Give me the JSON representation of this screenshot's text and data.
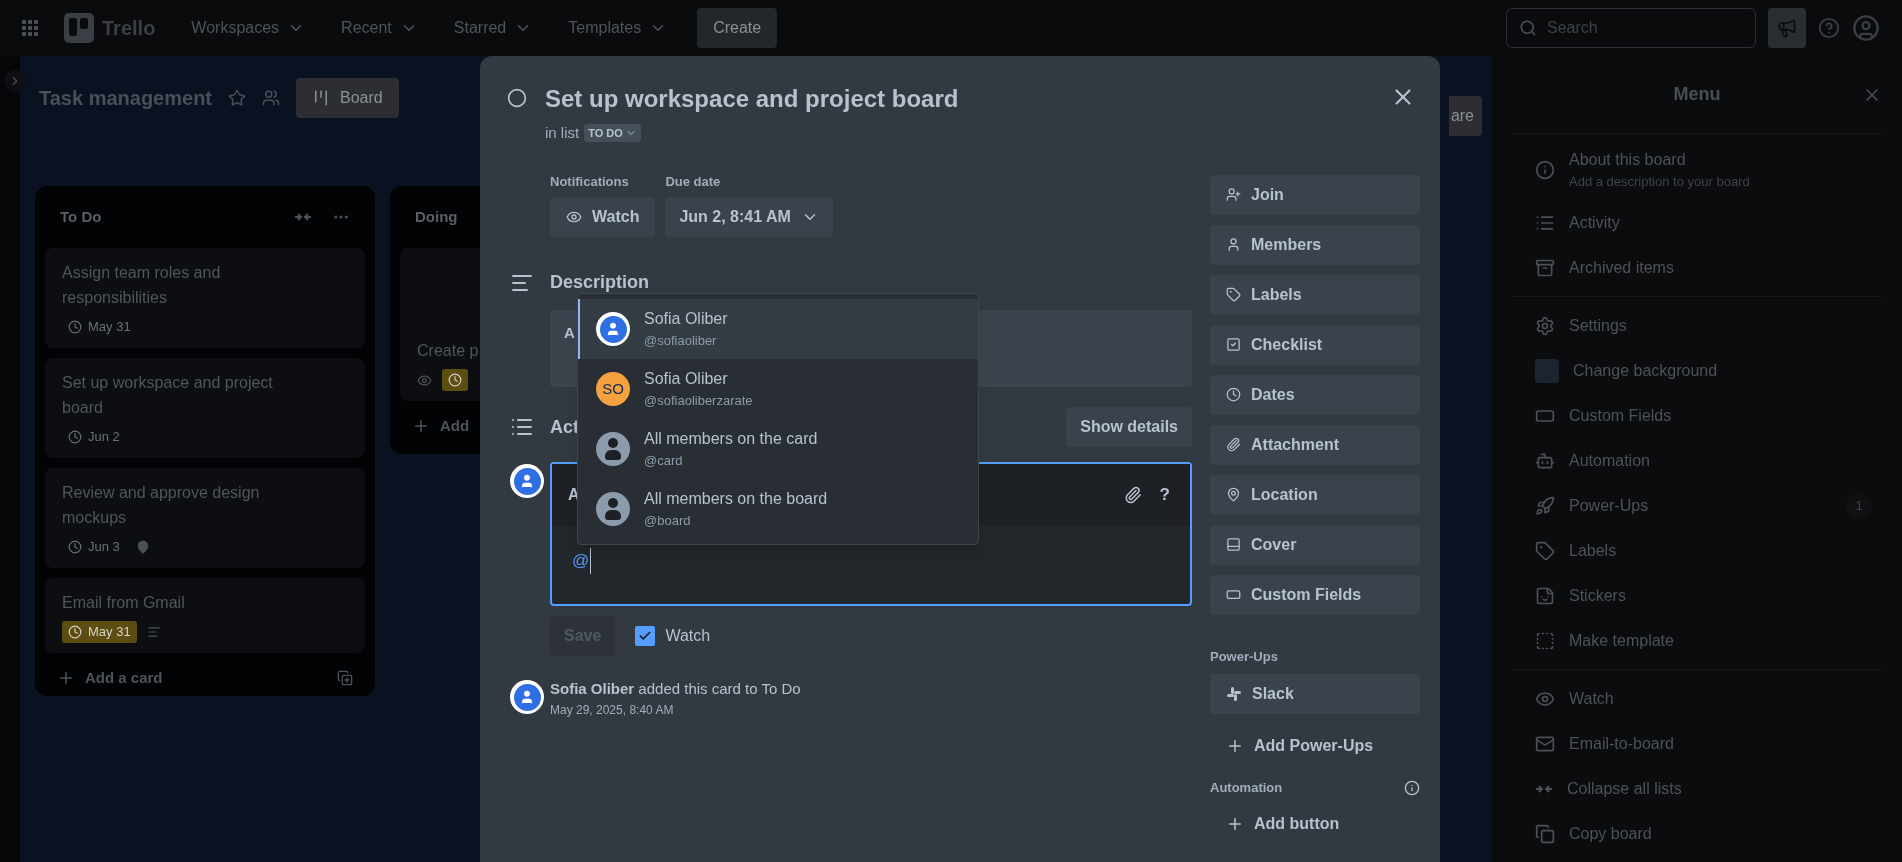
{
  "topbar": {
    "logo": "Trello",
    "nav": [
      {
        "label": "Workspaces"
      },
      {
        "label": "Recent"
      },
      {
        "label": "Starred"
      },
      {
        "label": "Templates"
      }
    ],
    "create": "Create",
    "search": {
      "placeholder": "Search"
    }
  },
  "board": {
    "title": "Task management",
    "view_button": "Board",
    "share_button": "are",
    "lists": [
      {
        "title": "To Do",
        "add_label": "Add a card",
        "cards": [
          {
            "title": "Assign team roles and responsibilities",
            "badges": [
              {
                "kind": "due",
                "text": "May 31",
                "highlight": false
              }
            ]
          },
          {
            "title": "Set up workspace and project board",
            "badges": [
              {
                "kind": "due",
                "text": "Jun 2",
                "highlight": false
              }
            ]
          },
          {
            "title": "Review and approve design mockups",
            "badges": [
              {
                "kind": "due",
                "text": "Jun 3",
                "highlight": false
              },
              {
                "kind": "location"
              }
            ]
          },
          {
            "title": "Email from Gmail",
            "badges": [
              {
                "kind": "due",
                "text": "May 31",
                "highlight": true
              },
              {
                "kind": "description"
              }
            ]
          }
        ]
      },
      {
        "title": "Doing",
        "add_label": "Add",
        "cards": [
          {
            "title": "Create p",
            "badges": [
              {
                "kind": "watch"
              },
              {
                "kind": "due",
                "highlight": true
              }
            ]
          }
        ]
      }
    ]
  },
  "card_modal": {
    "title": "Set up workspace and project board",
    "list_prefix": "in list",
    "list_name": "TO DO",
    "notifications_label": "Notifications",
    "watch_button": "Watch",
    "due_label": "Due date",
    "due_value": "Jun 2, 8:41 AM",
    "description_heading": "Description",
    "description_text": "A",
    "activity_heading": "Act",
    "show_details": "Show details",
    "comment": {
      "toolbar_text": "A",
      "help": "?",
      "value": "@",
      "save": "Save",
      "save_disabled": true,
      "watch_label": "Watch",
      "watch_checked": true
    },
    "mentions": [
      {
        "kind": "user",
        "name": "Sofia Oliber",
        "handle": "@sofiaoliber",
        "selected": true
      },
      {
        "kind": "initials",
        "initials": "SO",
        "name": "Sofia Oliber",
        "handle": "@sofiaoliberzarate",
        "selected": false
      },
      {
        "kind": "group",
        "name": "All members on the card",
        "handle": "@card",
        "selected": false
      },
      {
        "kind": "group",
        "name": "All members on the board",
        "handle": "@board",
        "selected": false
      }
    ],
    "activity": [
      {
        "author": "Sofia Oliber",
        "text": "added this card to To Do",
        "time": "May 29, 2025, 8:40 AM"
      }
    ],
    "actions": [
      {
        "label": "Join"
      },
      {
        "label": "Members"
      },
      {
        "label": "Labels"
      },
      {
        "label": "Checklist"
      },
      {
        "label": "Dates"
      },
      {
        "label": "Attachment"
      },
      {
        "label": "Location"
      },
      {
        "label": "Cover"
      },
      {
        "label": "Custom Fields"
      }
    ],
    "powerups_heading": "Power-Ups",
    "powerups": [
      {
        "label": "Slack"
      }
    ],
    "add_powerups": "Add Power-Ups",
    "automation_heading": "Automation",
    "add_button": "Add button"
  },
  "menu": {
    "title": "Menu",
    "sections": [
      [
        {
          "label": "About this board",
          "sub": "Add a description to your board"
        },
        {
          "label": "Activity"
        },
        {
          "label": "Archived items"
        }
      ],
      [
        {
          "label": "Settings"
        },
        {
          "label": "Change background"
        },
        {
          "label": "Custom Fields"
        },
        {
          "label": "Automation"
        },
        {
          "label": "Power-Ups",
          "count": "1"
        },
        {
          "label": "Labels"
        },
        {
          "label": "Stickers"
        },
        {
          "label": "Make template"
        }
      ],
      [
        {
          "label": "Watch"
        },
        {
          "label": "Email-to-board"
        },
        {
          "label": "Collapse all lists"
        },
        {
          "label": "Copy board"
        }
      ]
    ]
  }
}
